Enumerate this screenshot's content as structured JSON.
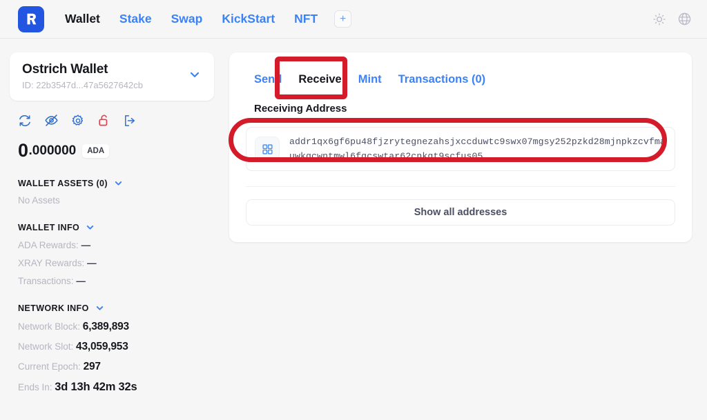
{
  "header": {
    "logo_letter": "R",
    "nav": [
      {
        "label": "Wallet",
        "active": true
      },
      {
        "label": "Stake",
        "active": false
      },
      {
        "label": "Swap",
        "active": false
      },
      {
        "label": "KickStart",
        "active": false
      },
      {
        "label": "NFT",
        "active": false
      }
    ],
    "add_tab_label": "+",
    "theme_icon": "sun-icon",
    "language_icon": "globe-icon"
  },
  "sidebar": {
    "wallet": {
      "name": "Ostrich Wallet",
      "id": "ID: 22b3547d...47a5627642cb",
      "caret_icon": "chevron-down-icon"
    },
    "actions": [
      {
        "name": "refresh-icon",
        "color": "#2f6fd0"
      },
      {
        "name": "eye-off-icon",
        "color": "#2f6fd0"
      },
      {
        "name": "gear-icon",
        "color": "#2f6fd0"
      },
      {
        "name": "unlock-icon",
        "color": "#e8414d"
      },
      {
        "name": "logout-icon",
        "color": "#2f6fd0"
      }
    ],
    "balance": {
      "integer": "0",
      "decimals": ".000000",
      "unit": "ADA"
    },
    "assets": {
      "title": "WALLET ASSETS (0)",
      "empty_text": "No Assets"
    },
    "wallet_info": {
      "title": "WALLET INFO",
      "rows": [
        {
          "label": "ADA Rewards:",
          "value": "—"
        },
        {
          "label": "XRAY Rewards:",
          "value": "—"
        },
        {
          "label": "Transactions:",
          "value": "—"
        }
      ]
    },
    "network_info": {
      "title": "NETWORK INFO",
      "rows": [
        {
          "label": "Network Block:",
          "value": "6,389,893"
        },
        {
          "label": "Network Slot:",
          "value": "43,059,953"
        },
        {
          "label": "Current Epoch:",
          "value": "297"
        },
        {
          "label": "Ends In:",
          "value": "3d 13h 42m 32s"
        }
      ]
    }
  },
  "main": {
    "tabs": [
      {
        "label": "Send",
        "active": false
      },
      {
        "label": "Receive",
        "active": true
      },
      {
        "label": "Mint",
        "active": false
      },
      {
        "label": "Transactions (0)",
        "active": false
      }
    ],
    "receiving_address_label": "Receiving Address",
    "address": "addr1qx6gf6pu48fjzrytegnezahsjxccduwtc9swx07mgsy252pzkd28mjnpkzcvfmauwkgcwntmwl6fqcswtar62cnkgt9scfus05",
    "qr_icon": "qr-code-icon",
    "show_all_label": "Show all addresses"
  },
  "annotations": {
    "highlight_color": "#d31b29",
    "boxes": [
      "receive-tab",
      "receiving-address"
    ]
  },
  "colors": {
    "brand_blue": "#2255e0",
    "link_blue": "#3b82f6",
    "red": "#e8414d",
    "page_bg": "#f6f6f7"
  }
}
